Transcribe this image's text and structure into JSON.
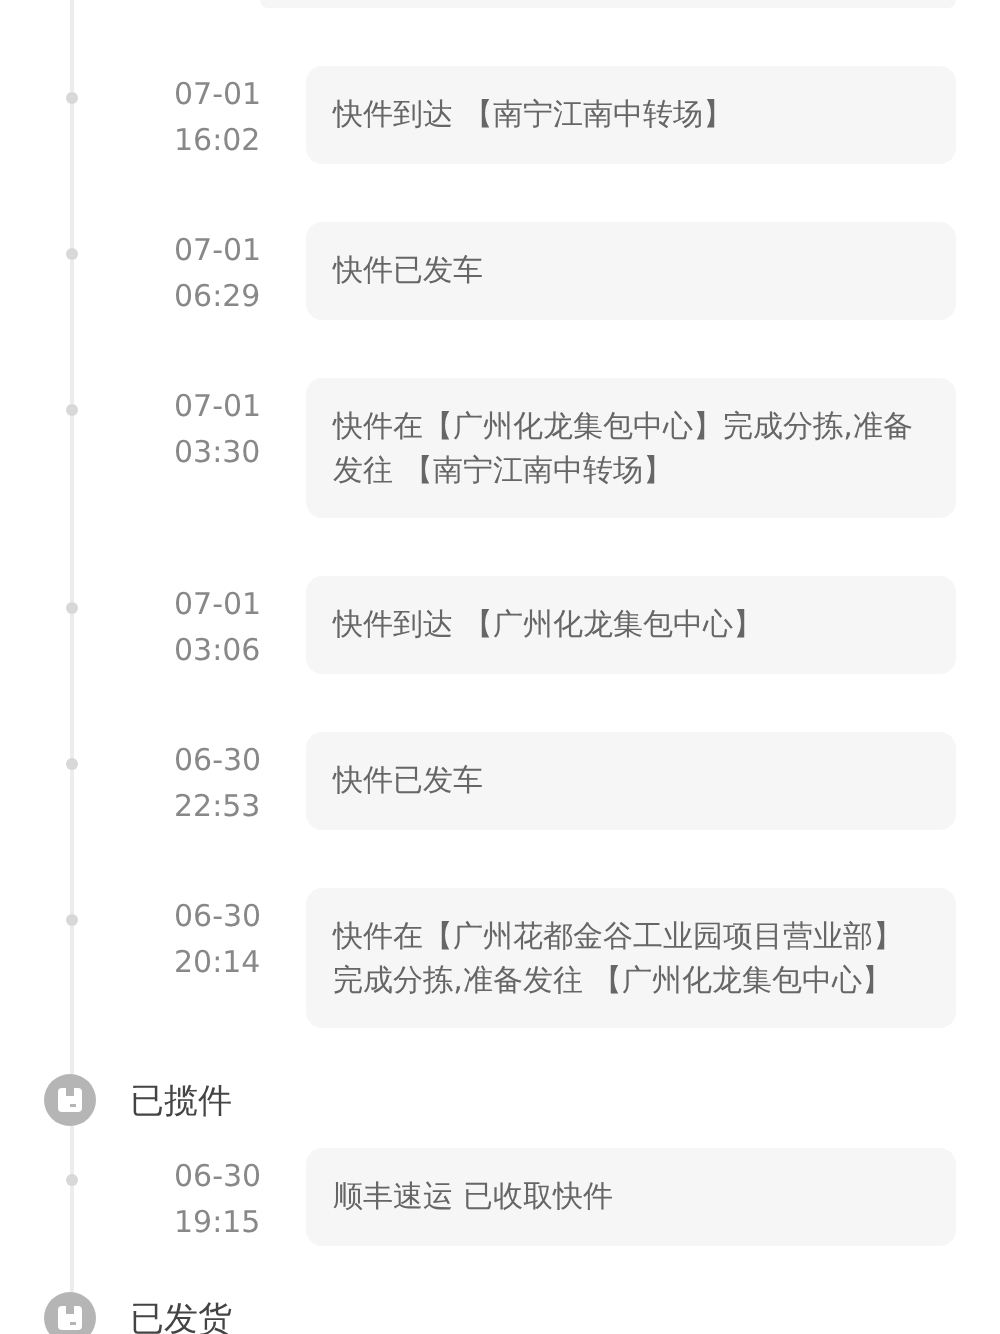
{
  "timeline": [
    {
      "kind": "event",
      "date": "07-01",
      "time": "16:02",
      "text": "快件到达 【南宁江南中转场】"
    },
    {
      "kind": "event",
      "date": "07-01",
      "time": "06:29",
      "text": "快件已发车"
    },
    {
      "kind": "event",
      "date": "07-01",
      "time": "03:30",
      "text": "快件在【广州化龙集包中心】完成分拣,准备发往 【南宁江南中转场】"
    },
    {
      "kind": "event",
      "date": "07-01",
      "time": "03:06",
      "text": "快件到达 【广州化龙集包中心】"
    },
    {
      "kind": "event",
      "date": "06-30",
      "time": "22:53",
      "text": "快件已发车"
    },
    {
      "kind": "event",
      "date": "06-30",
      "time": "20:14",
      "text": "快件在【广州花都金谷工业园项目营业部】完成分拣,准备发往 【广州化龙集包中心】"
    },
    {
      "kind": "status",
      "title": "已揽件"
    },
    {
      "kind": "event",
      "date": "06-30",
      "time": "19:15",
      "text": "顺丰速运 已收取快件"
    },
    {
      "kind": "status",
      "title": "已发货"
    }
  ]
}
